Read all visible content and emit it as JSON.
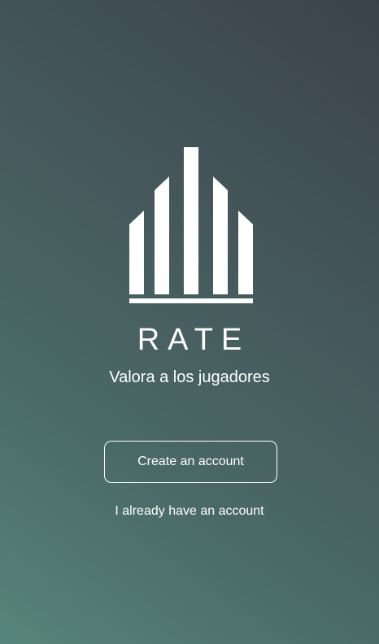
{
  "brand": {
    "logo_icon": "rate-bars-logo-icon",
    "name": "RATE",
    "tagline": "Valora a los jugadores"
  },
  "actions": {
    "create_account_label": "Create an account",
    "login_link_label": "I already have an account"
  },
  "colors": {
    "gradient_top_right": "#3b434a",
    "gradient_bottom_left": "#57857a",
    "foreground": "#ffffff"
  }
}
